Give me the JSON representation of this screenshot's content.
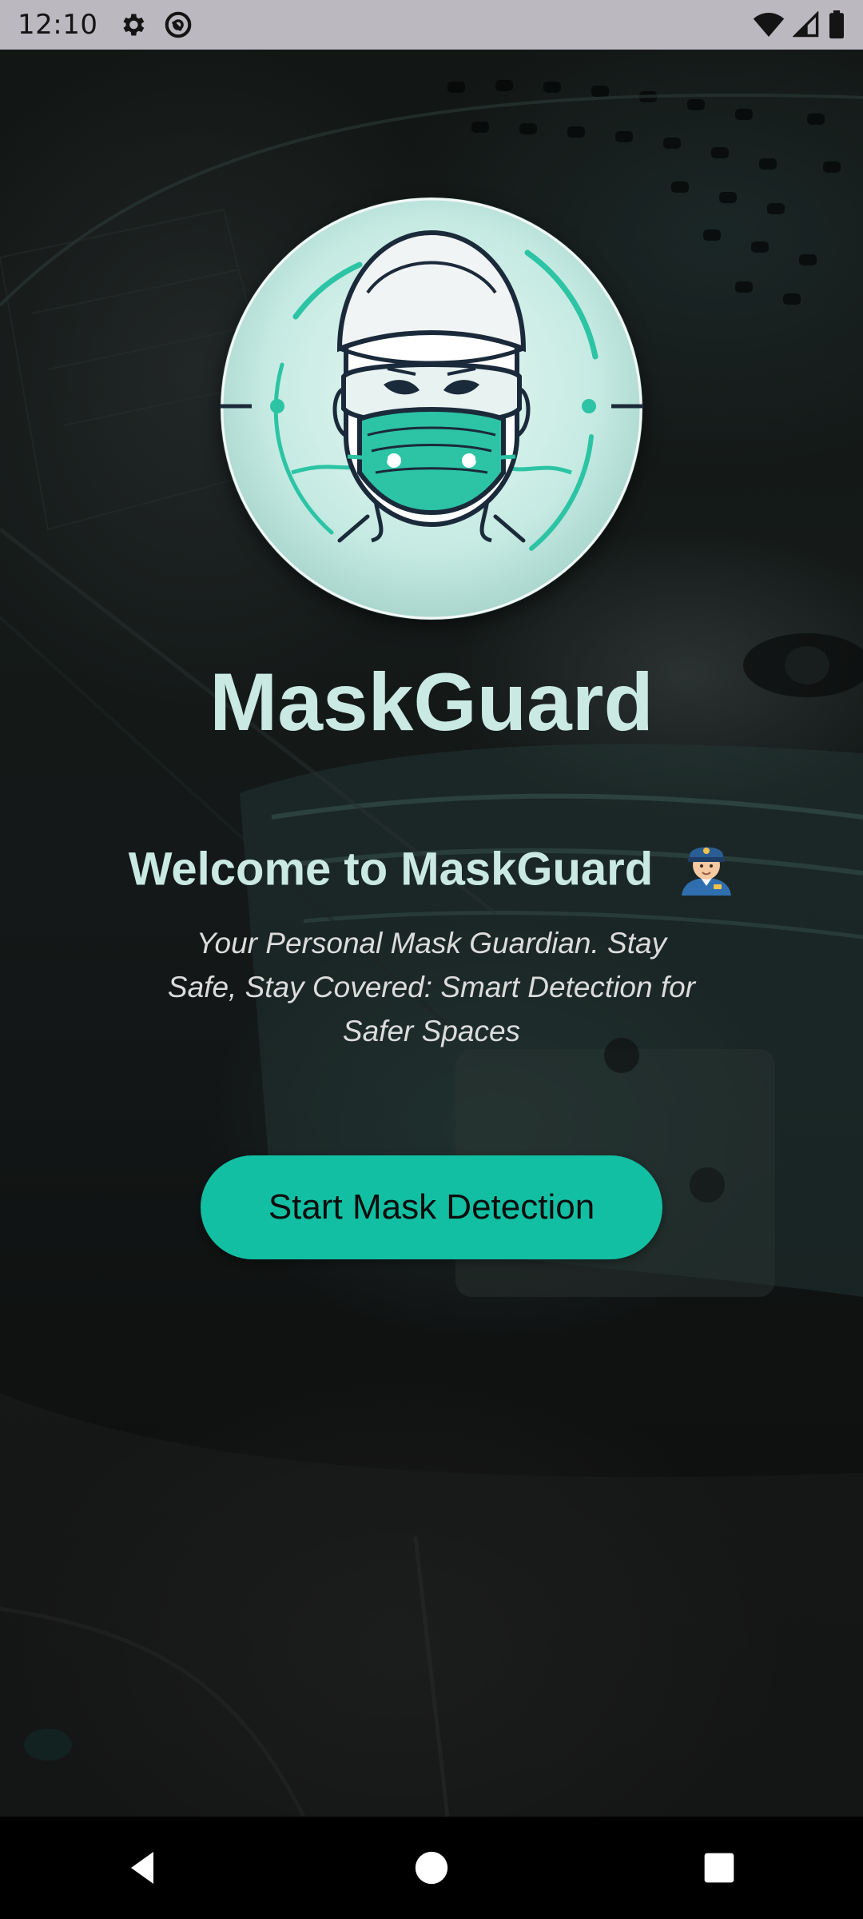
{
  "status_bar": {
    "time": "12:10",
    "icons": [
      "settings-gear-icon",
      "do-not-disturb-icon",
      "wifi-icon",
      "cellular-signal-icon",
      "battery-icon"
    ]
  },
  "app": {
    "title": "MaskGuard",
    "welcome": "Welcome to MaskGuard",
    "welcome_emoji": "police-officer-emoji",
    "tagline": "Your Personal Mask Guardian. Stay Safe, Stay Covered: Smart Detection for Safer Spaces",
    "tagline_lines": [
      "Your Personal Mask Guardian. Stay",
      "Safe, Stay Covered: Smart Detection for",
      "Safer Spaces"
    ],
    "start_button_label": "Start Mask Detection"
  },
  "colors": {
    "accent": "#12bfa3",
    "title_text": "#c9e9e2",
    "logo_bg": "#c6ebe3",
    "mask": "#2cc4a4",
    "outline": "#1b2a3a"
  },
  "nav_bar": {
    "buttons": [
      "back-icon",
      "home-icon",
      "recents-icon"
    ]
  }
}
